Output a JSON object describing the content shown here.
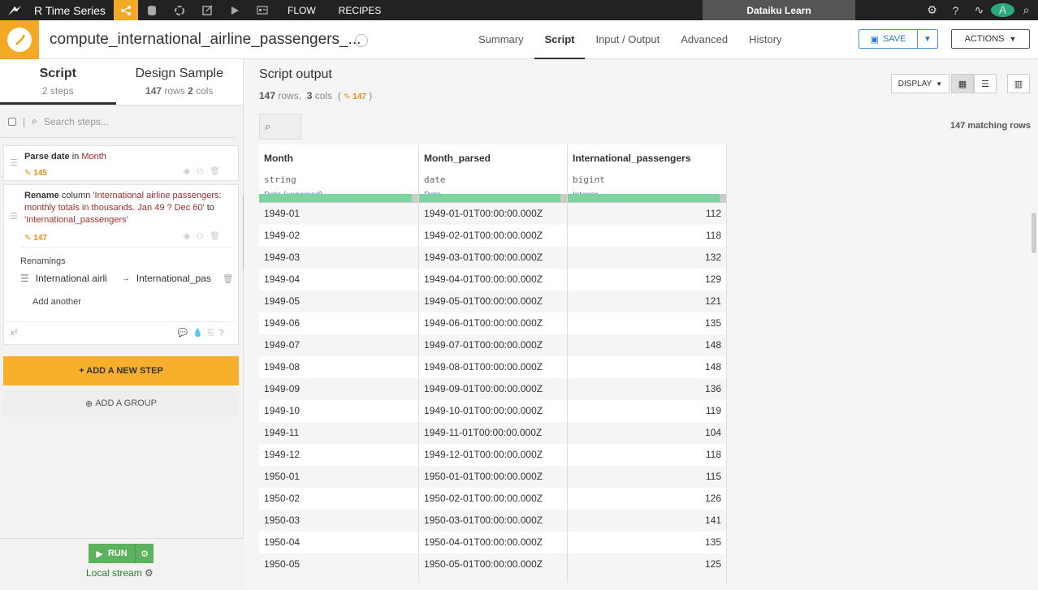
{
  "topbar": {
    "project_name": "R Time Series",
    "nav_flow": "FLOW",
    "nav_recipes": "RECIPES",
    "learn_label": "Dataiku Learn",
    "avatar_letter": "A"
  },
  "header": {
    "recipe_title": "compute_international_airline_passengers_...",
    "tabs": [
      {
        "label": "Summary"
      },
      {
        "label": "Script"
      },
      {
        "label": "Input / Output"
      },
      {
        "label": "Advanced"
      },
      {
        "label": "History"
      }
    ],
    "save_label": "SAVE",
    "actions_label": "ACTIONS"
  },
  "left": {
    "tab_script": {
      "title": "Script",
      "sub": "2 steps"
    },
    "tab_sample": {
      "title": "Design Sample",
      "rows": "147",
      "rows_label": "rows",
      "cols": "2",
      "cols_label": "cols"
    },
    "search_placeholder": "Search steps...",
    "steps": [
      {
        "action": "Parse date",
        "in_word": "in",
        "column": "Month",
        "count": "145"
      },
      {
        "action": "Rename",
        "col_word": "column",
        "from": "'International airline passengers: monthly totals in thousands. Jan 49 ? Dec 60'",
        "to_word": "to",
        "to": "'International_passengers'",
        "count": "147",
        "renamings_label": "Renamings",
        "rename_from": "International airli",
        "rename_to": "International_pas",
        "add_another": "Add another",
        "footer_left": "x²"
      }
    ],
    "add_step": "+ ADD A NEW STEP",
    "add_group": "ADD A GROUP",
    "run_label": "RUN",
    "stream_label": "Local stream"
  },
  "right": {
    "title": "Script output",
    "rows_num": "147",
    "rows_label": "rows,",
    "cols_num": "3",
    "cols_label": "cols",
    "badge_count": "147",
    "display_label": "DISPLAY",
    "matching": "147 matching rows",
    "columns": [
      {
        "name": "Month",
        "type": "string",
        "meaning": "Date (unparsed)"
      },
      {
        "name": "Month_parsed",
        "type": "date",
        "meaning": "Date"
      },
      {
        "name": "International_passengers",
        "type": "bigint",
        "meaning": "Integer"
      }
    ],
    "rows": [
      [
        "1949-01",
        "1949-01-01T00:00:00.000Z",
        "112"
      ],
      [
        "1949-02",
        "1949-02-01T00:00:00.000Z",
        "118"
      ],
      [
        "1949-03",
        "1949-03-01T00:00:00.000Z",
        "132"
      ],
      [
        "1949-04",
        "1949-04-01T00:00:00.000Z",
        "129"
      ],
      [
        "1949-05",
        "1949-05-01T00:00:00.000Z",
        "121"
      ],
      [
        "1949-06",
        "1949-06-01T00:00:00.000Z",
        "135"
      ],
      [
        "1949-07",
        "1949-07-01T00:00:00.000Z",
        "148"
      ],
      [
        "1949-08",
        "1949-08-01T00:00:00.000Z",
        "148"
      ],
      [
        "1949-09",
        "1949-09-01T00:00:00.000Z",
        "136"
      ],
      [
        "1949-10",
        "1949-10-01T00:00:00.000Z",
        "119"
      ],
      [
        "1949-11",
        "1949-11-01T00:00:00.000Z",
        "104"
      ],
      [
        "1949-12",
        "1949-12-01T00:00:00.000Z",
        "118"
      ],
      [
        "1950-01",
        "1950-01-01T00:00:00.000Z",
        "115"
      ],
      [
        "1950-02",
        "1950-02-01T00:00:00.000Z",
        "126"
      ],
      [
        "1950-03",
        "1950-03-01T00:00:00.000Z",
        "141"
      ],
      [
        "1950-04",
        "1950-04-01T00:00:00.000Z",
        "135"
      ],
      [
        "1950-05",
        "1950-05-01T00:00:00.000Z",
        "125"
      ]
    ]
  },
  "colors": {
    "accent": "#f3a826",
    "link": "#2a7bd0",
    "run": "#5db35d",
    "valid_bar": "#7fd3a0",
    "step_count": "#e88d0c"
  },
  "icons": {
    "logo": "bird-icon",
    "flow": "flow-icon",
    "datasets": "database-icon",
    "settings": "gear-icon",
    "help": "question-icon",
    "activity": "activity-icon",
    "search": "search-icon",
    "recipe": "brush-icon"
  }
}
